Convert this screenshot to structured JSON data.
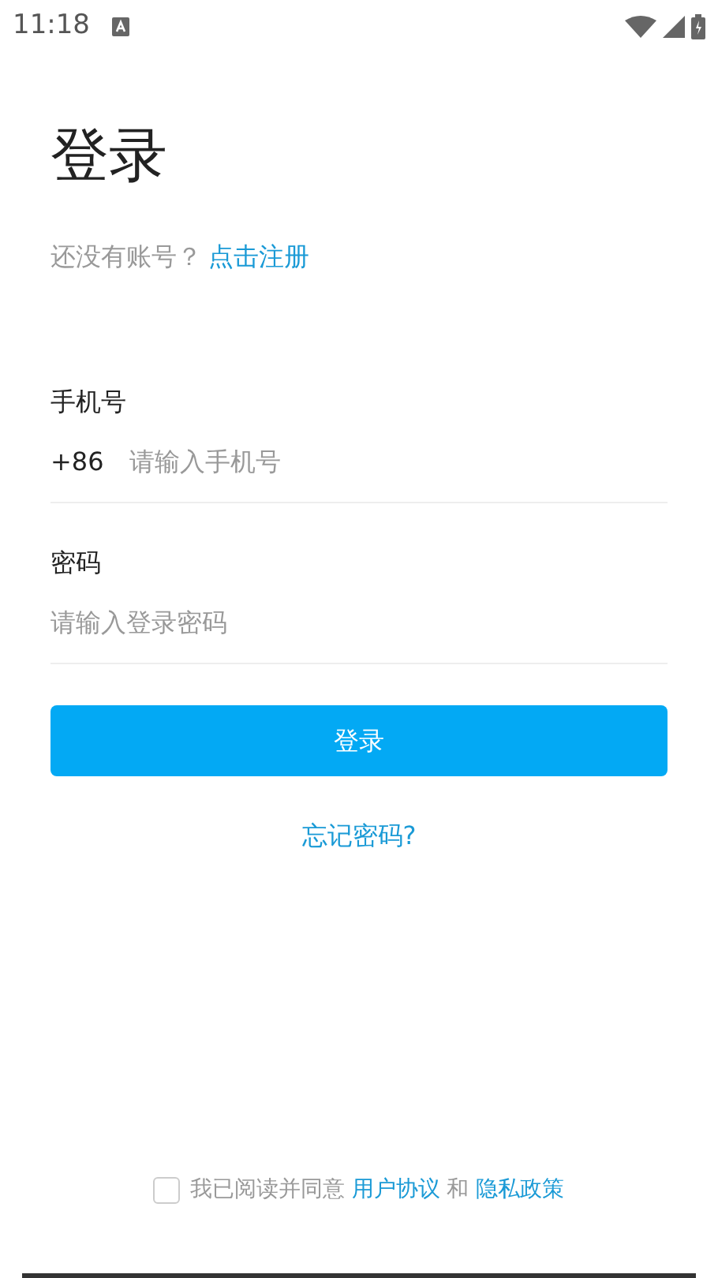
{
  "status_bar": {
    "time": "11:18"
  },
  "title": "登录",
  "register_prompt": {
    "text": "还没有账号？",
    "link": "点击注册"
  },
  "phone": {
    "label": "手机号",
    "prefix": "+86",
    "placeholder": "请输入手机号"
  },
  "password": {
    "label": "密码",
    "placeholder": "请输入登录密码"
  },
  "login_button": "登录",
  "forgot_link": "忘记密码?",
  "agreement": {
    "checked": false,
    "text": "我已阅读并同意",
    "link_1": "用户协议",
    "joiner": "和",
    "link_2": "隐私政策"
  }
}
